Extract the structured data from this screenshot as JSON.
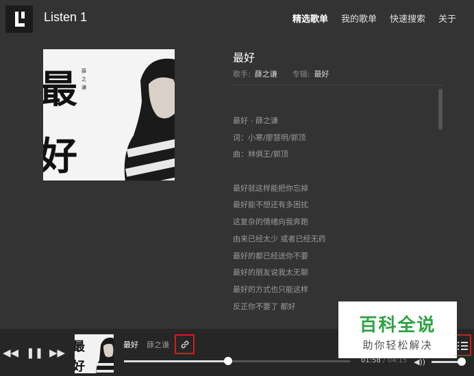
{
  "app": {
    "title": "Listen 1"
  },
  "nav": [
    {
      "label": "精选歌单",
      "active": true
    },
    {
      "label": "我的歌单",
      "active": false
    },
    {
      "label": "快速搜索",
      "active": false
    },
    {
      "label": "关于",
      "active": false
    }
  ],
  "cover": {
    "char1": "最",
    "char2": "好",
    "artist_vertical": "薛之谦"
  },
  "song": {
    "title": "最好",
    "artist_label": "歌手:",
    "artist": "薛之谦",
    "album_label": "专辑:",
    "album": "最好"
  },
  "lyrics": [
    "最好 - 薛之谦",
    "词：小寒/廖慧明/郭顶",
    "曲：林俱王/郭顶",
    "",
    "最好就这样能把你忘掉",
    "最好能不想还有多困扰",
    "这复杂的情绪向我奔跑",
    "由来已经太少 或者已经无药",
    "最好的都已经送你不要",
    "最好的朋友说我太无聊",
    "最好的方式也只能这样",
    "反正你不要了 都好"
  ],
  "watermark": {
    "title": "百科全说",
    "subtitle": "助你轻松解决"
  },
  "player": {
    "song": "最好",
    "artist": "薛之谦",
    "current_time": "01:58",
    "separator": "/",
    "total_time": "04:15",
    "progress": 0.46,
    "volume": 1.0,
    "icons": {
      "prev": "prev-icon",
      "play": "pause-icon",
      "next": "next-icon",
      "link": "link-icon",
      "volume": "volume-icon",
      "list": "playlist-icon"
    },
    "highlight_color": "#e01616"
  }
}
